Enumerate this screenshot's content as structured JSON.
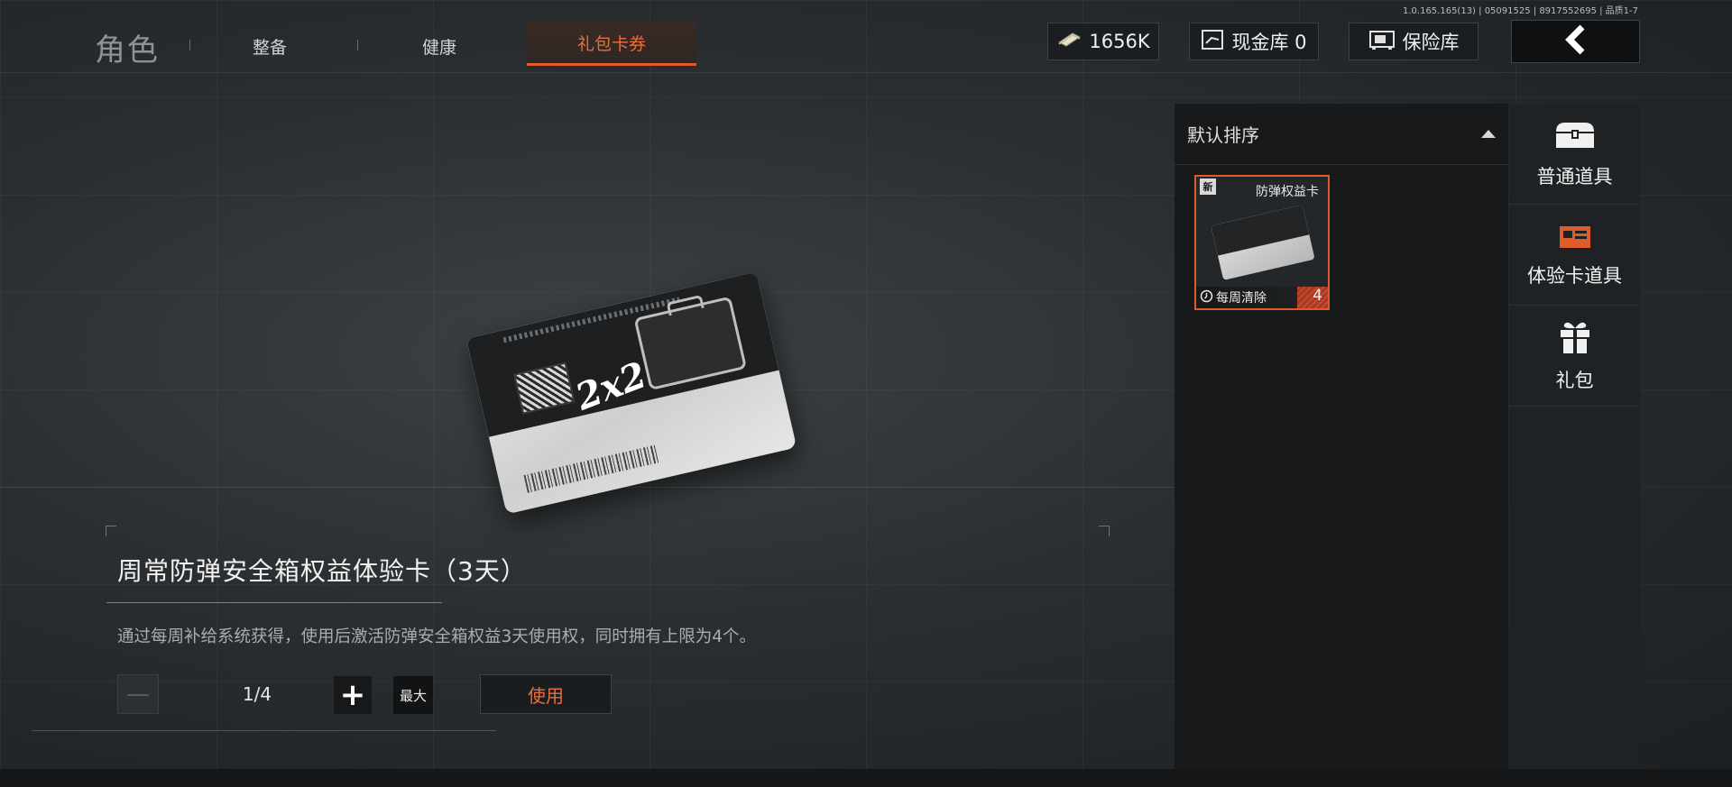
{
  "version": "1.0.165.165(13) | 05091525 | 8917552695 | 品质1-7",
  "tabs": {
    "role": "角色",
    "equip": "整备",
    "health": "健康",
    "gift": "礼包卡券"
  },
  "currency": {
    "money": "1656K",
    "cash_vault": "现金库 0",
    "safe": "保险库"
  },
  "item": {
    "title": "周常防弹安全箱权益体验卡（3天）",
    "description": "通过每周补给系统获得，使用后激活防弹安全箱权益3天使用权，同时拥有上限为4个。",
    "card_text": "2x2"
  },
  "quantity": {
    "minus": "—",
    "value": "1/4",
    "plus": "+",
    "max": "最大",
    "use": "使用"
  },
  "inventory": {
    "sort": "默认排序",
    "items": [
      {
        "badge": "新",
        "name": "防弹权益卡",
        "expiry": "每周清除",
        "count": "4"
      }
    ]
  },
  "categories": [
    {
      "label": "普通道具",
      "icon": "chest-icon"
    },
    {
      "label": "体验卡道具",
      "icon": "trial-card-icon"
    },
    {
      "label": "礼包",
      "icon": "gift-icon"
    }
  ],
  "colors": {
    "accent": "#e15b2a",
    "accent_text": "#ec6d3c"
  }
}
